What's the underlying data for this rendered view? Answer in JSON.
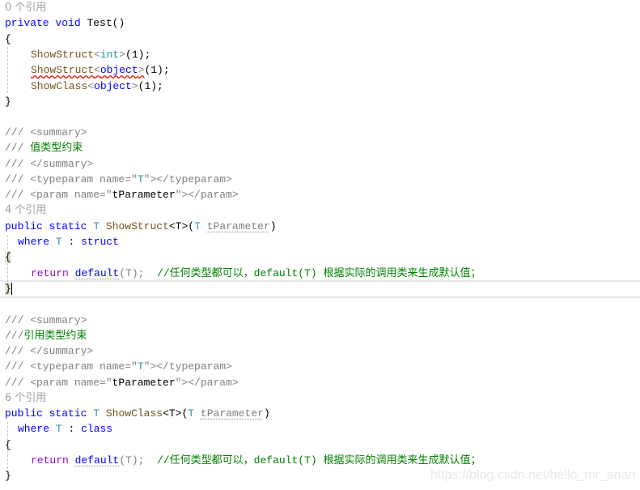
{
  "refs": {
    "test": "0 个引用",
    "show_struct": "4 个引用",
    "show_class": "6 个引用"
  },
  "test_method": {
    "modifiers": "private void",
    "name": "Test()",
    "open": "{",
    "close": "}",
    "calls": [
      {
        "method": "ShowStruct",
        "lt": "<",
        "type": "int",
        "gt": ">",
        "args": "(1);"
      },
      {
        "method": "ShowStruct",
        "lt": "<",
        "type": "object",
        "gt": ">",
        "args": "(1);",
        "error": true
      },
      {
        "method": "ShowClass",
        "lt": "<",
        "type": "object",
        "gt": ">",
        "args": "(1);"
      }
    ]
  },
  "struct_block": {
    "doc": {
      "summary_open": "/// <summary>",
      "summary_text_prefix": "/// ",
      "summary_text": "值类型约束",
      "summary_close": "/// </summary>",
      "typeparam_a": "/// <typeparam name=\"",
      "typeparam_t": "T",
      "typeparam_b": "\"></typeparam>",
      "param_a": "/// <param name=\"",
      "param_name": "tParameter",
      "param_b": "\"></param>"
    },
    "sig_mods": "public static",
    "sig_t": "T",
    "sig_name": "ShowStruct",
    "sig_generic": "<T>",
    "sig_paren_open": "(",
    "sig_param_type": "T",
    "sig_param_name": "tParameter",
    "sig_paren_close": ")",
    "where_kw": "where",
    "where_t": "T",
    "where_colon": ":",
    "where_constraint": "struct",
    "open": "{",
    "return_kw": "return",
    "default_kw": "default",
    "default_arg": "(T);",
    "comment": "//任何类型都可以，default(T) 根据实际的调用类来生成默认值；",
    "close": "}"
  },
  "class_block": {
    "doc": {
      "summary_open": "/// <summary>",
      "summary_text_prefix": "///",
      "summary_text": "引用类型约束",
      "summary_close": "/// </summary>",
      "typeparam_a": "/// <typeparam name=\"",
      "typeparam_t": "T",
      "typeparam_b": "\"></typeparam>",
      "param_a": "/// <param name=\"",
      "param_name": "tParameter",
      "param_b": "\"></param>"
    },
    "sig_mods": "public static",
    "sig_t": "T",
    "sig_name": "ShowClass",
    "sig_generic": "<T>",
    "sig_paren_open": "(",
    "sig_param_type": "T",
    "sig_param_name": "tParameter",
    "sig_paren_close": ")",
    "where_kw": "where",
    "where_t": "T",
    "where_colon": ":",
    "where_constraint": "class",
    "open": "{",
    "return_kw": "return",
    "default_kw": "default",
    "default_arg": "(T);",
    "comment": "//任何类型都可以，default(T) 根据实际的调用类来生成默认值；",
    "close": "}"
  },
  "watermark": "https://blog.csdn.net/hello_mr_anan"
}
